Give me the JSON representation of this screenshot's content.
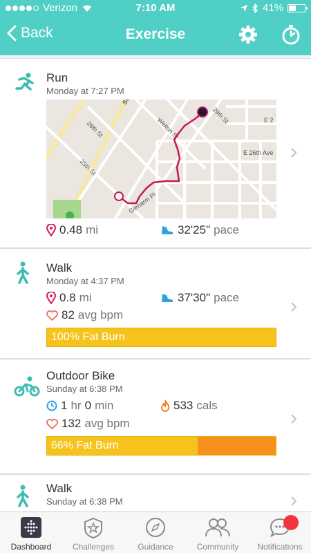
{
  "status": {
    "carrier": "Verizon",
    "time": "7:10 AM",
    "battery": "41%",
    "battery_level": 0.41
  },
  "nav": {
    "back_label": "Back",
    "title": "Exercise"
  },
  "colors": {
    "header": "#4fcfc5",
    "route": "#c2185b",
    "fat_burn": "#f6c31c",
    "cardio": "#f7911c",
    "notif_badge": "#f1363b"
  },
  "activities": [
    {
      "name": "Run",
      "time": "Monday at 7:27 PM",
      "icon": "run-icon",
      "map": {
        "streets": [
          "Stout",
          "26th St",
          "25th St",
          "Welton St",
          "29th St",
          "E 26th Ave",
          "Glenarm Pl",
          "E 2"
        ]
      },
      "stats": [
        {
          "icon": "location-pin-icon",
          "value": "0.48",
          "unit": "mi"
        },
        {
          "icon": "shoe-icon",
          "value": "32'25\"",
          "unit": "pace"
        }
      ]
    },
    {
      "name": "Walk",
      "time": "Monday at 4:37 PM",
      "icon": "walk-icon",
      "stats": [
        {
          "icon": "location-pin-icon",
          "value": "0.8",
          "unit": "mi"
        },
        {
          "icon": "shoe-icon",
          "value": "37'30\"",
          "unit": "pace"
        },
        {
          "icon": "heart-icon",
          "value": "82",
          "unit": "avg bpm"
        }
      ],
      "zone_bar": {
        "label": "100% Fat Burn",
        "fat_burn_fraction": 1.0
      }
    },
    {
      "name": "Outdoor Bike",
      "time": "Sunday at 6:38 PM",
      "icon": "bike-icon",
      "stats": [
        {
          "icon": "clock-icon",
          "value1": "1",
          "unit1": "hr",
          "value2": "0",
          "unit2": "min"
        },
        {
          "icon": "flame-icon",
          "value": "533",
          "unit": "cals"
        },
        {
          "icon": "heart-icon",
          "value": "132",
          "unit": "avg bpm"
        }
      ],
      "zone_bar": {
        "label": "66% Fat Burn",
        "fat_burn_fraction": 0.66
      }
    },
    {
      "name": "Walk",
      "time": "Sunday at 6:38 PM",
      "icon": "walk-icon"
    }
  ],
  "tabs": [
    {
      "label": "Dashboard",
      "icon": "dashboard-icon",
      "active": true
    },
    {
      "label": "Challenges",
      "icon": "star-shield-icon"
    },
    {
      "label": "Guidance",
      "icon": "compass-icon"
    },
    {
      "label": "Community",
      "icon": "people-icon"
    },
    {
      "label": "Notifications",
      "icon": "chat-bubble-icon"
    }
  ]
}
